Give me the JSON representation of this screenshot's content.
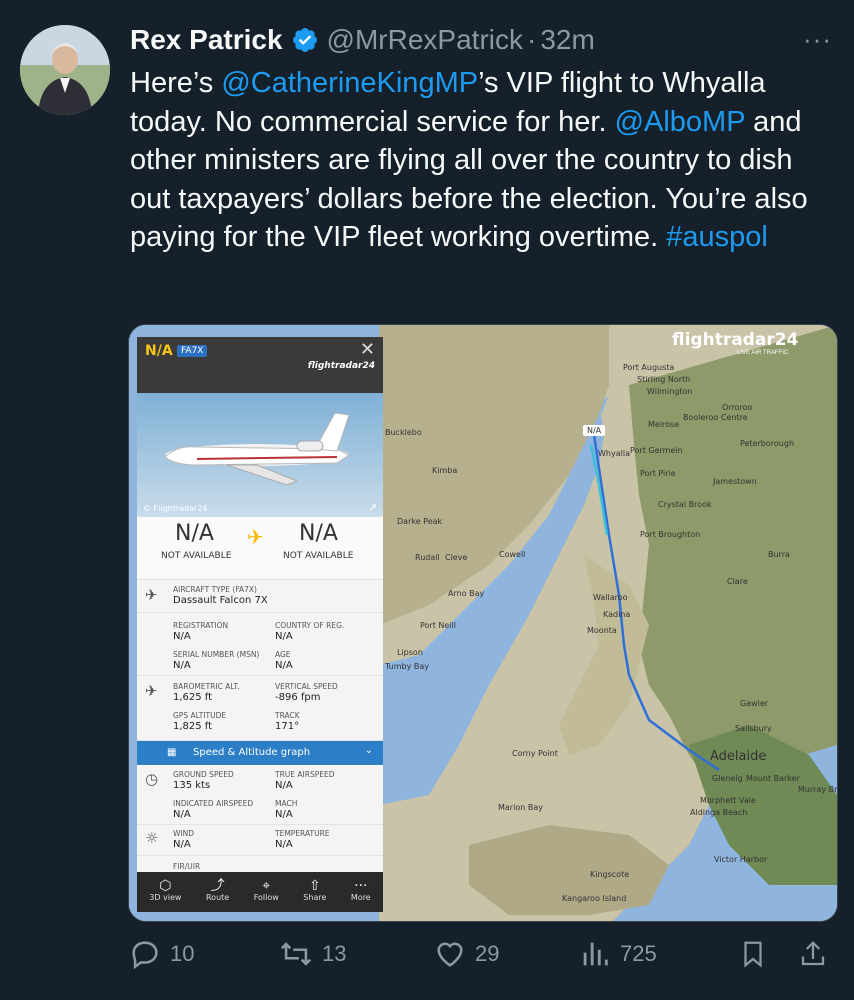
{
  "tweet": {
    "author_name": "Rex Patrick",
    "handle": "@MrRexPatrick",
    "separator": "·",
    "time": "32m",
    "more": "···",
    "body": [
      {
        "t": "Here’s ",
        "link": false
      },
      {
        "t": "@CatherineKingMP",
        "link": true
      },
      {
        "t": "’s VIP flight to Whyalla today. No commercial service for her. ",
        "link": false
      },
      {
        "t": "@AlboMP",
        "link": true
      },
      {
        "t": " and other ministers are flying all over the country to dish out taxpayers’ dollars before the election. You’re also paying for the VIP fleet working overtime. ",
        "link": false
      },
      {
        "t": "#auspol",
        "link": true
      }
    ]
  },
  "media": {
    "brand": "flightradar24",
    "brand_sub": "LIVE AIR TRAFFIC",
    "panel": {
      "callsign": "N/A",
      "aircraft_code": "FA7X",
      "close": "✕",
      "panel_brand": "flightradar24",
      "photo_credit": "© Flightradar24",
      "origin": "N/A",
      "origin_sub": "NOT AVAILABLE",
      "dest": "N/A",
      "dest_sub": "NOT AVAILABLE",
      "aircraft_type_label": "AIRCRAFT TYPE (FA7X)",
      "aircraft_type": "Dassault Falcon 7X",
      "registration_label": "REGISTRATION",
      "registration": "N/A",
      "country_label": "COUNTRY OF REG.",
      "country": "N/A",
      "serial_label": "SERIAL NUMBER (MSN)",
      "serial": "N/A",
      "age_label": "AGE",
      "age": "N/A",
      "baro_label": "BAROMETRIC ALT.",
      "baro": "1,625 ft",
      "vs_label": "VERTICAL SPEED",
      "vs": "-896 fpm",
      "gps_label": "GPS ALTITUDE",
      "gps": "1,825 ft",
      "track_label": "TRACK",
      "track": "171°",
      "graph_label": "Speed & Altitude graph",
      "gs_label": "GROUND SPEED",
      "gs": "135 kts",
      "tas_label": "TRUE AIRSPEED",
      "tas": "N/A",
      "ias_label": "INDICATED AIRSPEED",
      "ias": "N/A",
      "mach_label": "MACH",
      "mach": "N/A",
      "wind_label": "WIND",
      "wind": "N/A",
      "temp_label": "TEMPERATURE",
      "temp": "N/A",
      "fir_label": "FIR/UIR",
      "buttons": [
        "3D view",
        "Route",
        "Follow",
        "Share",
        "More"
      ]
    },
    "map_labels": [
      "Port Augusta",
      "Stirling North",
      "Wilmington",
      "Orroroo",
      "Booleroo Centre",
      "Melrose",
      "Peterborough",
      "Port Germein",
      "Port Pirie",
      "Jamestown",
      "Crystal Brook",
      "Port Broughton",
      "Burra",
      "Clare",
      "Bucklebo",
      "Kimba",
      "Darke Peak",
      "Rudall",
      "Cleve",
      "Cowell",
      "Arno Bay",
      "Port Neill",
      "Tumby Bay",
      "Lipson",
      "Wallaroo",
      "Kadina",
      "Moonta",
      "Gawler",
      "Salisbury",
      "Adelaide",
      "Glenelg",
      "Mount Barker",
      "Murray Br",
      "Morphett Vale",
      "Aldinga Beach",
      "Victor Harbor",
      "Corny Point",
      "Marion Bay",
      "Kingscote",
      "Kangaroo Island",
      "N/A",
      "Whyalla"
    ]
  },
  "actions": {
    "replies": "10",
    "retweets": "13",
    "likes": "29",
    "views": "725"
  },
  "colors": {
    "bg": "#15202b",
    "link": "#1d9bf0",
    "muted": "#8b98a5",
    "track": "#2f6fd8"
  }
}
